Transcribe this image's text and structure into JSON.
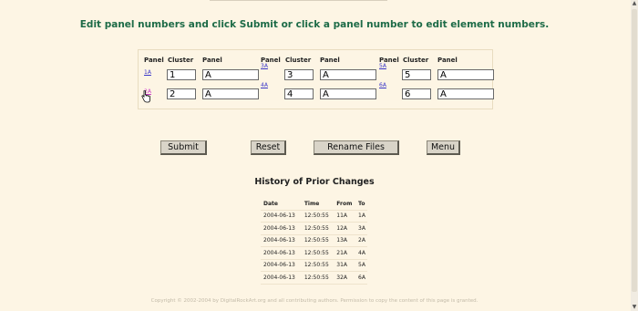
{
  "instruction": "Edit panel numbers and click Submit or click a panel number to edit element numbers.",
  "panel_table": {
    "headers": {
      "panel": "Panel",
      "cluster": "Cluster",
      "panel_input": "Panel"
    },
    "columns": [
      {
        "rows": [
          {
            "link": "1A",
            "cluster": "1",
            "panel": "A"
          },
          {
            "link": "2A",
            "cluster": "2",
            "panel": "A"
          }
        ]
      },
      {
        "rows": [
          {
            "link": "3A",
            "cluster": "3",
            "panel": "A"
          },
          {
            "link": "4A",
            "cluster": "4",
            "panel": "A"
          }
        ]
      },
      {
        "rows": [
          {
            "link": "5A",
            "cluster": "5",
            "panel": "A"
          },
          {
            "link": "6A",
            "cluster": "6",
            "panel": "A"
          }
        ]
      }
    ]
  },
  "buttons": {
    "submit": "Submit",
    "reset": "Reset",
    "rename": "Rename Files",
    "menu": "Menu"
  },
  "history": {
    "title": "History of Prior Changes",
    "headers": [
      "Date",
      "Time",
      "From",
      "To"
    ],
    "rows": [
      [
        "2004-06-13",
        "12:50:55",
        "11A",
        "1A"
      ],
      [
        "2004-06-13",
        "12:50:55",
        "12A",
        "3A"
      ],
      [
        "2004-06-13",
        "12:50:55",
        "13A",
        "2A"
      ],
      [
        "2004-06-13",
        "12:50:55",
        "21A",
        "4A"
      ],
      [
        "2004-06-13",
        "12:50:55",
        "31A",
        "5A"
      ],
      [
        "2004-06-13",
        "12:50:55",
        "32A",
        "6A"
      ]
    ]
  },
  "footer": "Copyright © 2002-2004 by DigitalRockArt.org and all contributing authors. Permission to copy the content of this page is granted.",
  "colors": {
    "background": "#fdf5e4",
    "instruction": "#1d6b47",
    "link": "#3a36c8",
    "visited_link": "#c838c8"
  },
  "icons": {
    "cursor": "hand-pointer-icon",
    "scroll_up": "scroll-up-arrow-icon",
    "scroll_down": "scroll-down-arrow-icon"
  }
}
